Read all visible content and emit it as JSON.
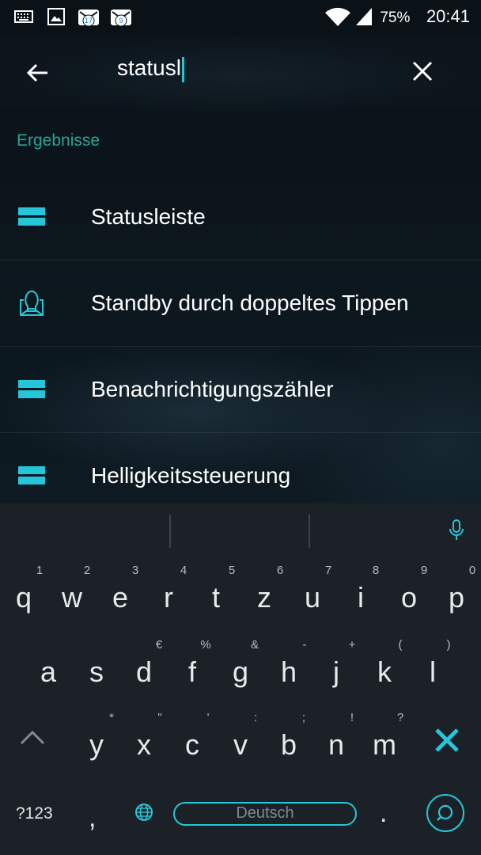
{
  "status_bar": {
    "battery": "75%",
    "time": "20:41",
    "notifications": [
      {
        "icon": "keyboard-icon"
      },
      {
        "icon": "image-icon"
      },
      {
        "icon": "mail-badge-icon",
        "count": "17"
      },
      {
        "icon": "mail-badge-icon",
        "count": "9"
      }
    ]
  },
  "search": {
    "query": "statusl"
  },
  "results_label": "Ergebnisse",
  "results": [
    {
      "label": "Statusleiste",
      "icon": "statusbar-icon"
    },
    {
      "label": "Standby durch doppeltes Tippen",
      "icon": "doubletap-icon"
    },
    {
      "label": "Benachrichtigungszähler",
      "icon": "statusbar-icon"
    },
    {
      "label": "Helligkeitssteuerung",
      "icon": "statusbar-icon"
    }
  ],
  "keyboard": {
    "row1": [
      {
        "key": "q",
        "hint": "1"
      },
      {
        "key": "w",
        "hint": "2"
      },
      {
        "key": "e",
        "hint": "3"
      },
      {
        "key": "r",
        "hint": "4"
      },
      {
        "key": "t",
        "hint": "5"
      },
      {
        "key": "z",
        "hint": "6"
      },
      {
        "key": "u",
        "hint": "7"
      },
      {
        "key": "i",
        "hint": "8"
      },
      {
        "key": "o",
        "hint": "9"
      },
      {
        "key": "p",
        "hint": "0"
      }
    ],
    "row2": [
      {
        "key": "a",
        "hint": ""
      },
      {
        "key": "s",
        "hint": ""
      },
      {
        "key": "d",
        "hint": "€"
      },
      {
        "key": "f",
        "hint": "%"
      },
      {
        "key": "g",
        "hint": "&"
      },
      {
        "key": "h",
        "hint": "-"
      },
      {
        "key": "j",
        "hint": "+"
      },
      {
        "key": "k",
        "hint": "("
      },
      {
        "key": "l",
        "hint": ")"
      }
    ],
    "row3": [
      {
        "key": "y",
        "hint": "*"
      },
      {
        "key": "x",
        "hint": "\""
      },
      {
        "key": "c",
        "hint": "'"
      },
      {
        "key": "v",
        "hint": ":"
      },
      {
        "key": "b",
        "hint": ";"
      },
      {
        "key": "n",
        "hint": "!"
      },
      {
        "key": "m",
        "hint": "?"
      }
    ],
    "symbols_label": "?123",
    "comma": ",",
    "space_label": "Deutsch",
    "period": ".",
    "accent": "#26c6da"
  }
}
